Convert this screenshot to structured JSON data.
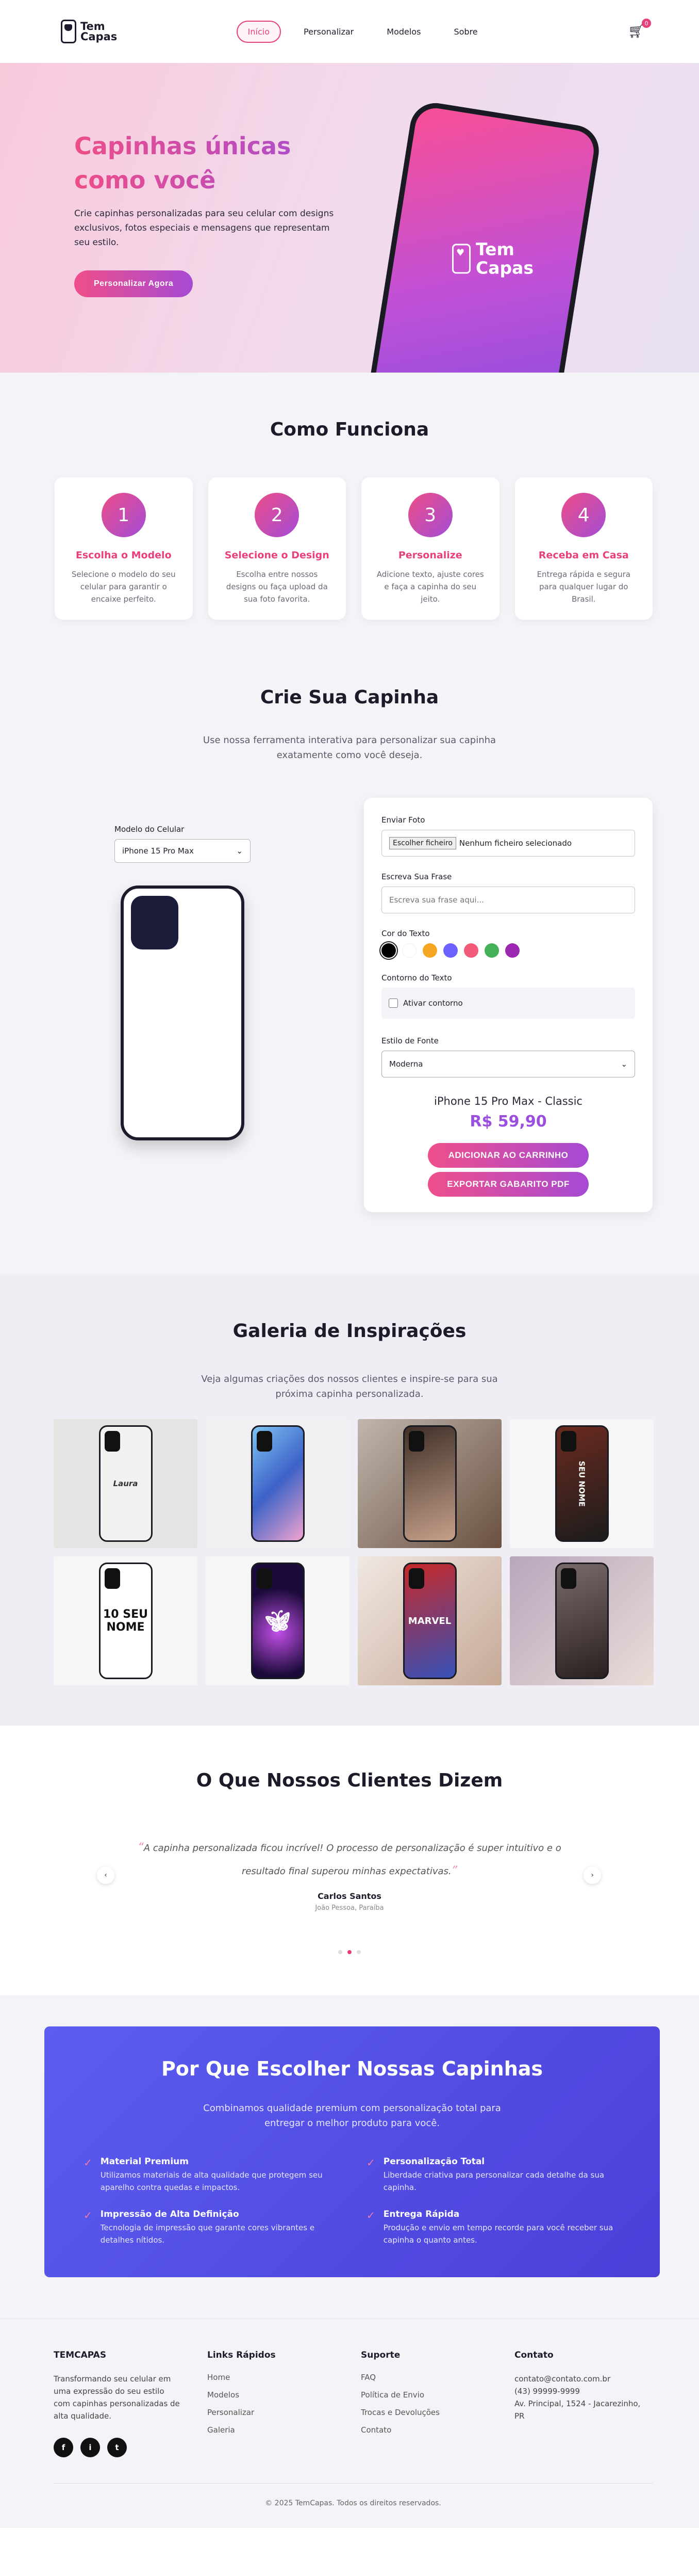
{
  "header": {
    "logo": "Tem Capas",
    "logo_line1": "Tem",
    "logo_line2": "Capas",
    "nav": [
      "Início",
      "Personalizar",
      "Modelos",
      "Sobre"
    ],
    "cart_count": "0"
  },
  "hero": {
    "title_line1": "Capinhas únicas",
    "title_line2": "como você",
    "subtitle": "Crie capinhas personalizadas para seu celular com designs exclusivos, fotos especiais e mensagens que representam seu estilo.",
    "cta": "Personalizar Agora",
    "phone_line1": "Tem",
    "phone_line2": "Capas"
  },
  "how": {
    "title": "Como Funciona",
    "steps": [
      {
        "num": "1",
        "title": "Escolha o Modelo",
        "desc": "Selecione o modelo do seu celular para garantir o encaixe perfeito."
      },
      {
        "num": "2",
        "title": "Selecione o Design",
        "desc": "Escolha entre nossos designs ou faça upload da sua foto favorita."
      },
      {
        "num": "3",
        "title": "Personalize",
        "desc": "Adicione texto, ajuste cores e faça a capinha do seu jeito."
      },
      {
        "num": "4",
        "title": "Receba em Casa",
        "desc": "Entrega rápida e segura para qualquer lugar do Brasil."
      }
    ]
  },
  "create": {
    "title": "Crie Sua Capinha",
    "subtitle": "Use nossa ferramenta interativa para personalizar sua capinha exatamente como você deseja.",
    "model_label": "Modelo do Celular",
    "model_value": "iPhone 15 Pro Max",
    "photo_label": "Enviar Foto",
    "file_button": "Escolher ficheiro",
    "file_status": "Nenhum ficheiro selecionado",
    "phrase_label": "Escreva Sua Frase",
    "phrase_placeholder": "Escreva sua frase aqui...",
    "color_label": "Cor do Texto",
    "colors": [
      "#000000",
      "#ffffff",
      "#f5a623",
      "#6c63ff",
      "#f25c7a",
      "#44b058",
      "#9c27b0"
    ],
    "outline_label": "Contorno do Texto",
    "outline_check": "Ativar contorno",
    "font_label": "Estilo de Fonte",
    "font_value": "Moderna",
    "product": "iPhone 15 Pro Max - Classic",
    "price": "R$ 59,90",
    "btn_cart": "ADICIONAR AO CARRINHO",
    "btn_pdf": "EXPORTAR GABARITO PDF"
  },
  "gallery": {
    "title": "Galeria de Inspirações",
    "subtitle": "Veja algumas criações dos nossos clientes e inspire-se para sua próxima capinha personalizada.",
    "texts": [
      "Laura",
      "SEU NOME",
      "10 SEU NOME",
      "MARVEL"
    ]
  },
  "testimonials": {
    "title": "O Que Nossos Clientes Dizem",
    "quote": "A capinha personalizada ficou incrível! O processo de personalização é super intuitivo e o resultado final superou minhas expectativas.",
    "name": "Carlos Santos",
    "location": "João Pessoa, Paraíba"
  },
  "why": {
    "title": "Por Que Escolher Nossas Capinhas",
    "subtitle": "Combinamos qualidade premium com personalização total para entregar o melhor produto para você.",
    "features": [
      {
        "title": "Material Premium",
        "desc": "Utilizamos materiais de alta qualidade que protegem seu aparelho contra quedas e impactos."
      },
      {
        "title": "Personalização Total",
        "desc": "Liberdade criativa para personalizar cada detalhe da sua capinha."
      },
      {
        "title": "Impressão de Alta Definição",
        "desc": "Tecnologia de impressão que garante cores vibrantes e detalhes nítidos."
      },
      {
        "title": "Entrega Rápida",
        "desc": "Produção e envio em tempo recorde para você receber sua capinha o quanto antes."
      }
    ]
  },
  "footer": {
    "brand": "TEMCAPAS",
    "about": "Transformando seu celular em uma expressão do seu estilo com capinhas personalizadas de alta qualidade.",
    "socials": [
      "f",
      "i",
      "t"
    ],
    "links_title": "Links Rápidos",
    "links": [
      "Home",
      "Modelos",
      "Personalizar",
      "Galeria"
    ],
    "support_title": "Suporte",
    "support": [
      "FAQ",
      "Política de Envio",
      "Trocas e Devoluções",
      "Contato"
    ],
    "contact_title": "Contato",
    "contact": [
      "contato@contato.com.br",
      "(43) 99999-9999",
      "Av. Principal, 1524 - Jacarezinho, PR"
    ],
    "copyright": "© 2025 TemCapas. Todos os direitos reservados."
  }
}
